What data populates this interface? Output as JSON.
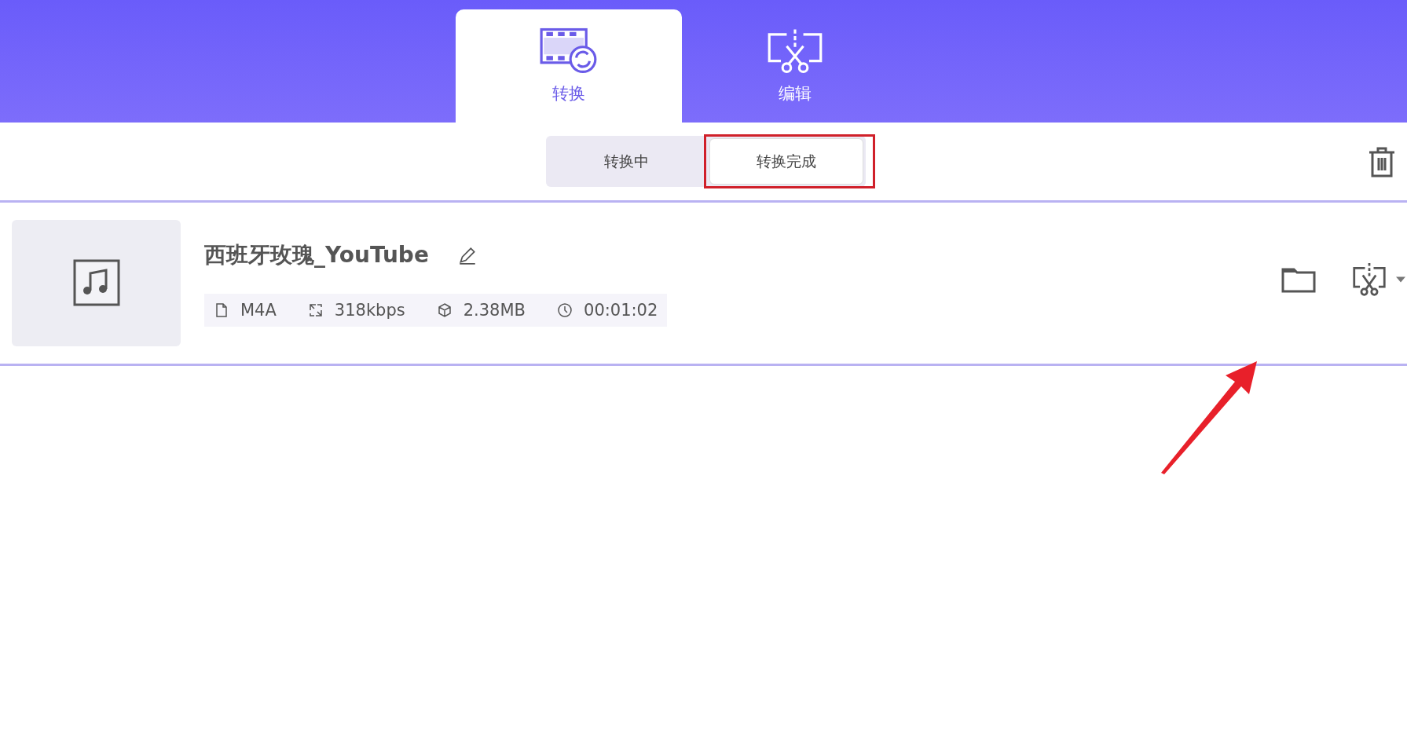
{
  "main_tabs": [
    {
      "label": "转换",
      "kind": "convert",
      "selected": true
    },
    {
      "label": "编辑",
      "kind": "edit",
      "selected": false
    }
  ],
  "sub_tabs": [
    {
      "label": "转换中",
      "selected": false,
      "highlighted": false
    },
    {
      "label": "转换完成",
      "selected": true,
      "highlighted": true
    }
  ],
  "files": [
    {
      "title": "西班牙玫瑰_YouTube",
      "format": "M4A",
      "bitrate": "318kbps",
      "size": "2.38MB",
      "duration": "00:01:02"
    }
  ],
  "annotation_arrow": true
}
